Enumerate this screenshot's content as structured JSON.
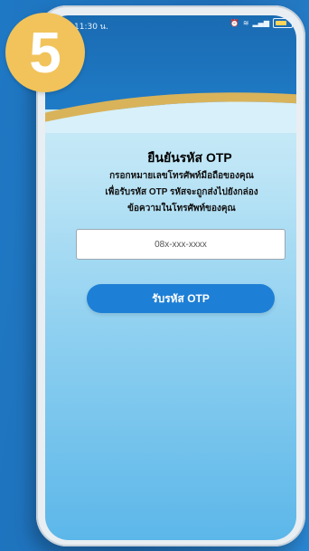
{
  "status_bar": {
    "time": "11:30 น.",
    "icons": [
      "alarm-icon",
      "vibrate-icon",
      "signal-icon",
      "battery-icon"
    ]
  },
  "step_badge": {
    "number": "5"
  },
  "otp": {
    "title": "ยืนยันรหัส OTP",
    "description_lines": [
      "กรอกหมายเลขโทรศัพท์มือถือของคุณ",
      "เพื่อรับรหัส OTP รหัสจะถูกส่งไปยังกล่อง",
      "ข้อความในโทรศัพท์ของคุณ"
    ],
    "phone_placeholder": "08x-xxx-xxxx",
    "button_label": "รับรหัส OTP"
  },
  "colors": {
    "background": "#1f78c4",
    "badge": "#f1c35a",
    "button": "#1e7fd6",
    "gold_accent": "#d9b35a"
  }
}
